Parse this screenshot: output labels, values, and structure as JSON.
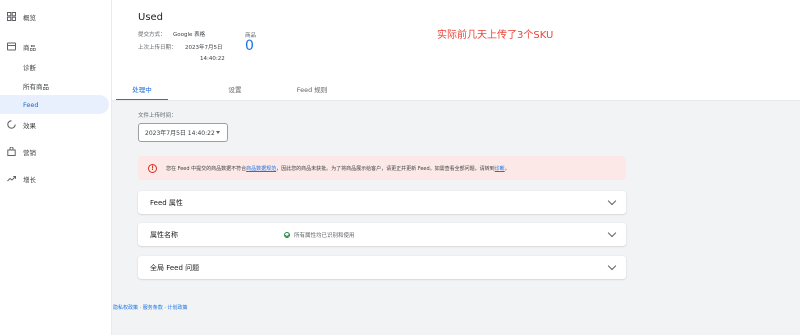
{
  "sidebar": {
    "items": [
      {
        "label": "概览",
        "icon": "dashboard-icon"
      },
      {
        "label": "商品",
        "icon": "products-icon"
      },
      {
        "label": "效果",
        "icon": "performance-icon"
      },
      {
        "label": "营销",
        "icon": "marketing-icon"
      },
      {
        "label": "增长",
        "icon": "growth-icon"
      }
    ],
    "sub_items": [
      "诊断",
      "所有商品",
      "Feed"
    ]
  },
  "header": {
    "feed_name": "Used",
    "method_label": "提交方式：",
    "method_value": "Google 表格",
    "upload_label": "上次上传日期：",
    "upload_date": "2023年7月5日",
    "upload_time": "14:40:22",
    "products_label": "商品",
    "products_count": "0",
    "annotation": "实际前几天上传了3个SKU"
  },
  "tabs": [
    "处理中",
    "设置",
    "Feed 规则"
  ],
  "main": {
    "upload_time_label": "文件上传时间：",
    "upload_time_value": "2023年7月5日 14:40:22",
    "alert": {
      "text_before": "您在 Feed 中提交的商品数据不符合",
      "link1": "商品数据规范",
      "text_middle": "，因此您的商品未获批。为了将商品展示给客户，请更正并更新 Feed。如需查看全部问题，请转到",
      "link2": "诊断",
      "text_after": "。"
    },
    "panels": {
      "feed_attributes": "Feed 属性",
      "attribute_name": "属性名称",
      "attribute_status": "所有属性均已识别和使用",
      "global_issues": "全局 Feed 问题"
    },
    "footer": "隐私权政策 · 服务条款 · 计划政策"
  },
  "colors": {
    "accent": "#1a73e8",
    "annotation": "#ea4335",
    "alert_bg": "#fce8e6",
    "error": "#d93025",
    "success": "#1e8e3e"
  }
}
